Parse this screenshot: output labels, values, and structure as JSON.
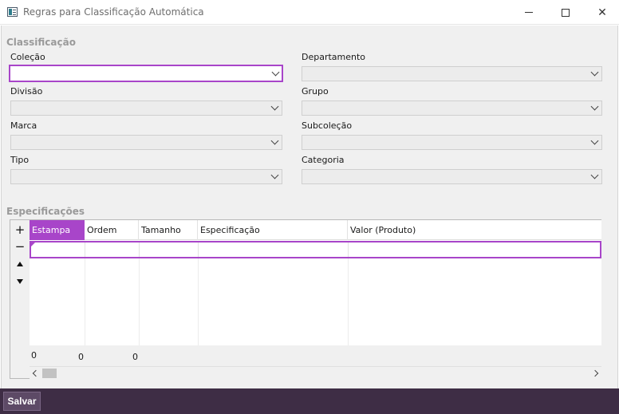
{
  "window": {
    "title": "Regras para Classificação Automática",
    "minimize_icon": "minimize-icon",
    "maximize_icon": "maximize-icon",
    "close_label": "✕"
  },
  "classificacao": {
    "section_title": "Classificação",
    "fields": {
      "colecao": {
        "label": "Coleção",
        "value": ""
      },
      "departamento": {
        "label": "Departamento",
        "value": ""
      },
      "divisao": {
        "label": "Divisão",
        "value": ""
      },
      "grupo": {
        "label": "Grupo",
        "value": ""
      },
      "marca": {
        "label": "Marca",
        "value": ""
      },
      "subcolecao": {
        "label": "Subcoleção",
        "value": ""
      },
      "tipo": {
        "label": "Tipo",
        "value": ""
      },
      "categoria": {
        "label": "Categoria",
        "value": ""
      }
    }
  },
  "especificacoes": {
    "section_title": "Especificações",
    "toolbar": {
      "add_label": "+",
      "remove_label": "−"
    },
    "columns": [
      "Estampa",
      "Ordem",
      "Tamanho",
      "Especificação",
      "Valor (Produto)"
    ],
    "footer": [
      "0",
      "0",
      "0"
    ]
  },
  "actions": {
    "save_label": "Salvar"
  },
  "colors": {
    "accent": "#a845c9",
    "bottom_bar": "#3e2d45",
    "section_title": "#9a9a9a"
  }
}
